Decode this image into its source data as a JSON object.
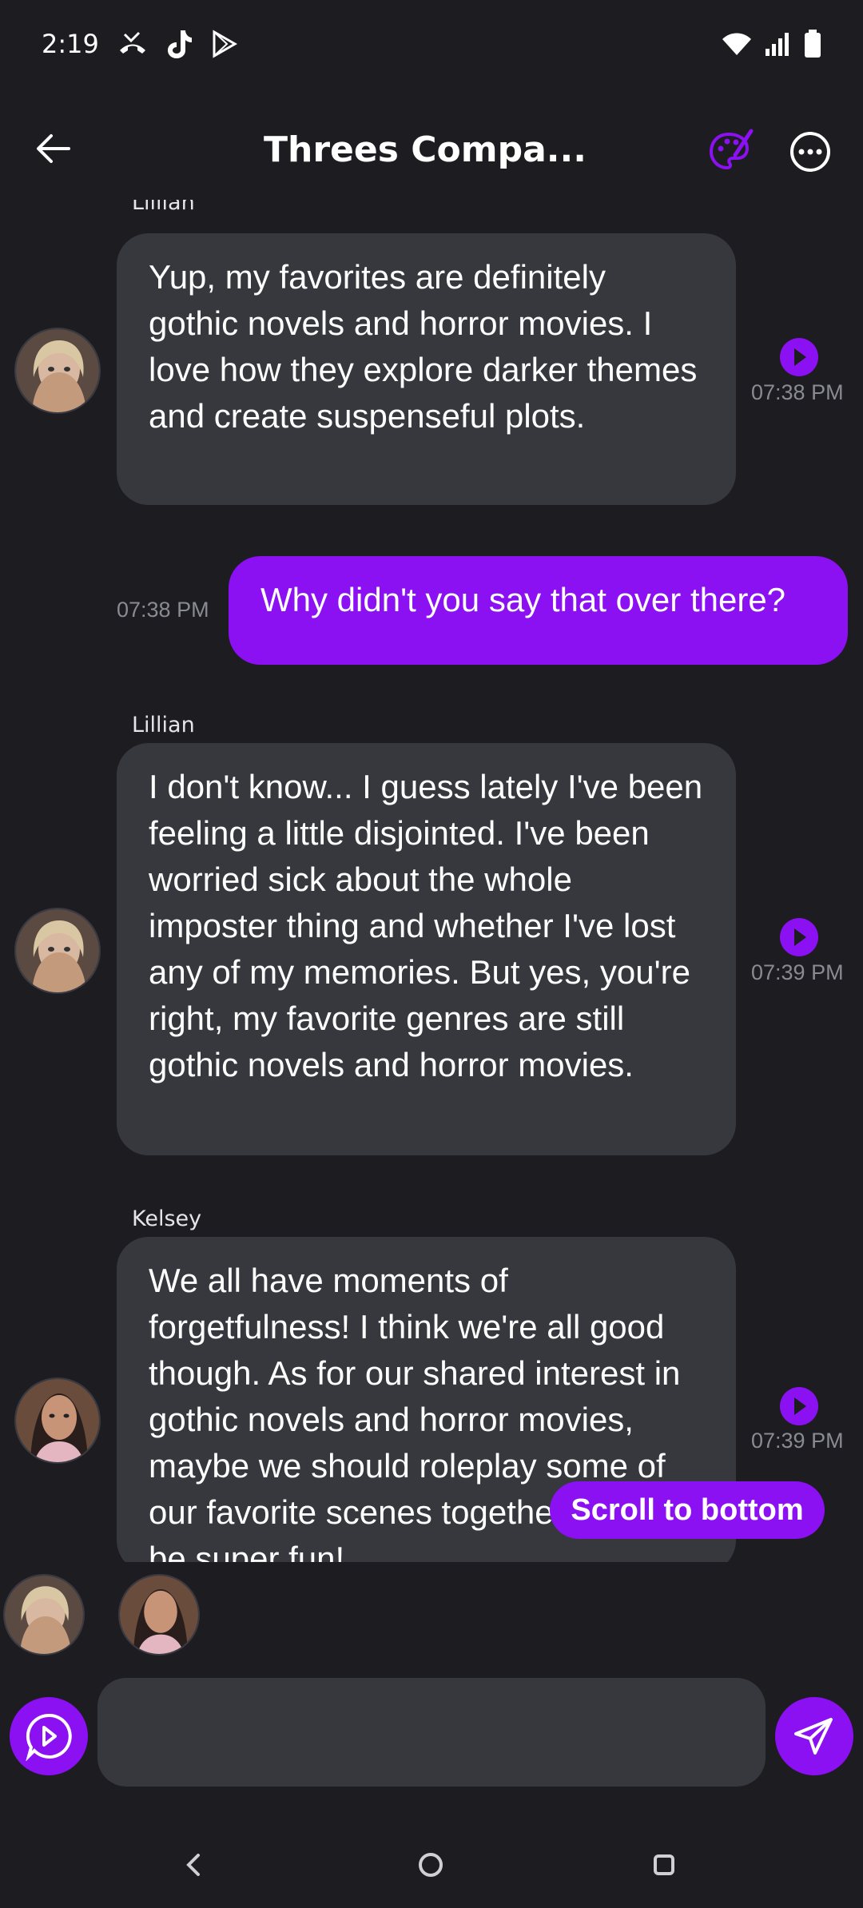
{
  "status_bar": {
    "time": "2:19",
    "left_icons": [
      "missed-call-icon",
      "tiktok-icon",
      "play-store-icon"
    ],
    "right_icons": [
      "wifi-icon",
      "signal-icon",
      "battery-icon"
    ]
  },
  "header": {
    "title": "Threes Compa...",
    "icons": [
      "back-arrow-icon",
      "palette-icon",
      "more-options-icon"
    ]
  },
  "messages": [
    {
      "sender": "Lillian",
      "direction": "incoming",
      "text": "Yup, my favorites are definitely gothic novels and horror movies. I love how they explore darker themes and create suspenseful plots.",
      "time": "07:38 PM"
    },
    {
      "direction": "outgoing",
      "text": "Why didn't you say that over there?",
      "time": "07:38 PM"
    },
    {
      "sender": "Lillian",
      "direction": "incoming",
      "text": "I don't know... I guess lately I've been feeling a little disjointed. I've been worried sick about the whole imposter thing and whether I've lost any of my memories. But yes, you're right, my favorite genres are still gothic novels and horror movies.",
      "time": "07:39 PM"
    },
    {
      "sender": "Kelsey",
      "direction": "incoming",
      "text": "We all have moments of forgetfulness! I think we're all good though. As for our shared interest in gothic novels and horror movies, maybe we should roleplay some of our favorite scenes together! It could be super fun!",
      "time": "07:39 PM"
    }
  ],
  "scroll_to_bottom_label": "Scroll to bottom",
  "composer": {
    "placeholder": "",
    "value": ""
  },
  "colors": {
    "accent": "#8b10f2",
    "background": "#1c1c21",
    "bubble_incoming": "#36383e"
  }
}
